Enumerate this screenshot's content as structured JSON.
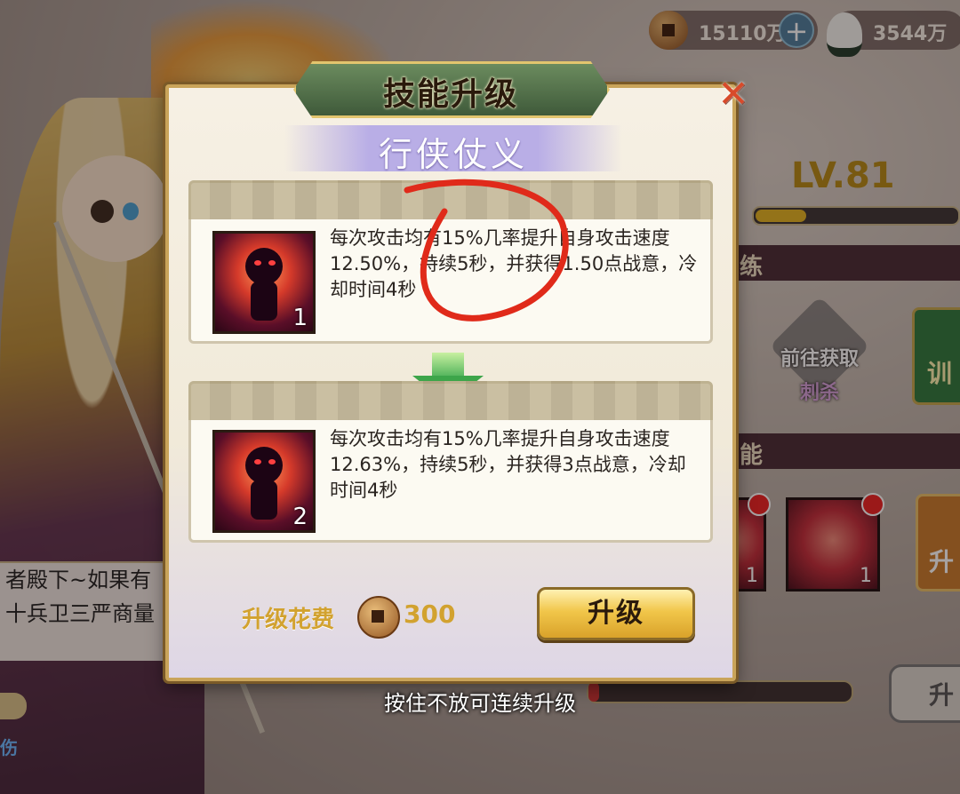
{
  "currency": {
    "coins": "15110万",
    "rice": "3544万"
  },
  "modal": {
    "title": "技能升级",
    "skill_name": "行侠仗义",
    "current": {
      "level": "1",
      "description": "每次攻击均有15%几率提升自身攻击速度12.50%，持续5秒，并获得1.50点战意，冷却时间4秒"
    },
    "next": {
      "level": "2",
      "description": "每次攻击均有15%几率提升自身攻击速度12.63%，持续5秒，并获得3点战意，冷却时间4秒"
    },
    "cost_label": "升级花费",
    "cost_value": "300",
    "upgrade_button": "升级"
  },
  "hint": "按住不放可连续升级",
  "background": {
    "level": "LV.81",
    "level_progress": 0.25,
    "stripe1": "练",
    "stripe2": "能",
    "goto_label": "前往获取",
    "goto_sub": "刺杀",
    "side_train": "训",
    "side_upgrade": "升",
    "right_button": "升",
    "skill_count_a": "1",
    "skill_count_b": "1",
    "dialogue_line1": "者殿下~如果有",
    "dialogue_line2": "十兵卫三严商量",
    "left_badge": "伤"
  },
  "colors": {
    "accent_gold": "#d2a22f",
    "annotation_red": "#e02a1a",
    "title_plate": "#4f6b48"
  }
}
